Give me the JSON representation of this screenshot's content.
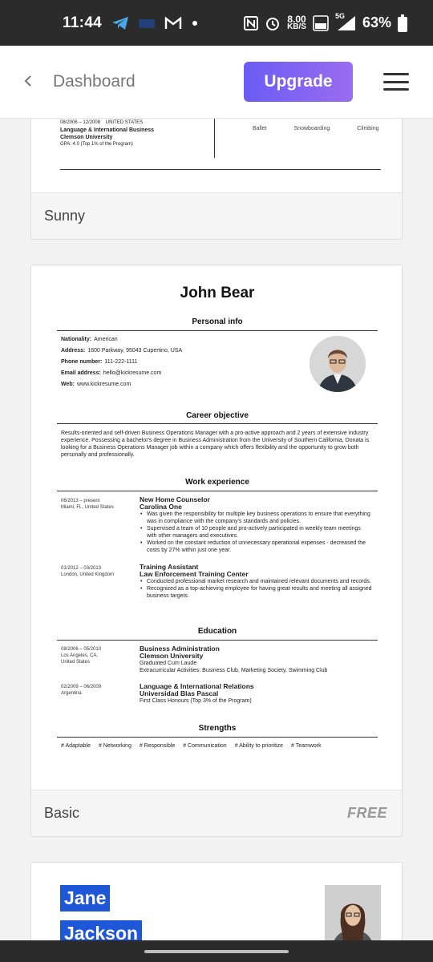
{
  "status_bar": {
    "time": "11:44",
    "speed_value": "8.00",
    "speed_unit": "KB/S",
    "network": "5G",
    "battery": "63%",
    "icons": [
      "telegram-icon",
      "message-icon",
      "gmail-icon",
      "dot-icon",
      "nfc-icon",
      "alarm-icon",
      "volte-icon",
      "signal-icon",
      "battery-icon"
    ]
  },
  "header": {
    "back_icon": "chevron-left-icon",
    "title": "Dashboard",
    "upgrade_label": "Upgrade",
    "menu_icon": "hamburger-menu-icon"
  },
  "cards": [
    {
      "name": "Sunny",
      "snippet": {
        "dates": "08/2006 – 12/2008",
        "location": "UNITED STATES",
        "degree": "Language & International Business",
        "school": "Clemson University",
        "gpa": "GPA: 4.0 (Top 1% of the Program)"
      },
      "hobbies": [
        "Ballet",
        "Snowboarding",
        "Climbing"
      ]
    },
    {
      "name": "Basic",
      "badge": "FREE",
      "resume": {
        "name": "John Bear",
        "sections": {
          "personal": "Personal info",
          "career": "Career objective",
          "work": "Work experience",
          "education": "Education",
          "strengths": "Strengths"
        },
        "personal_info": [
          {
            "label": "Nationality:",
            "value": "American"
          },
          {
            "label": "Address:",
            "value": "1600 Parkway, 95043 Cupertino, USA"
          },
          {
            "label": "Phone number:",
            "value": "111-222-1111"
          },
          {
            "label": "Email address:",
            "value": "hello@kickresume.com"
          },
          {
            "label": "Web:",
            "value": "www.kickresume.com"
          }
        ],
        "career_objective": "Results-oriented and self-driven Business Operations Manager with a pro-active approach and 2 years of extensive industry experience. Possessing a bachelor's degree in Business Administration from the University of Southern California, Donata is looking for a Business Operations Manager job within a company which offers flexibility and the opportunity to grow both personally and professionally.",
        "work": [
          {
            "dates": "06/2013 – present",
            "location": "Miami, FL, United States",
            "title": "New Home Counselor",
            "company": "Carolina One",
            "bullets": [
              "Was given the responsibility for multiple key business operations to ensure that everything was in compliance with the company's standards and policies.",
              "Supervised a team of 10 people and pro-actively participated in weekly team meetings with other managers and executives.",
              "Worked on the constant reduction of unnecessary operational expenses - decreased the costs by 27% within just one year."
            ]
          },
          {
            "dates": "01/2012 – 03/2013",
            "location": "London, United Kingdom",
            "title": "Training Assistant",
            "company": "Law Enforcement Training Center",
            "bullets": [
              "Conducted professional market research and maintained relevant documents and records.",
              "Recognized as a top-achieving employee for having great results and meeting all assigned business targets."
            ]
          }
        ],
        "education": [
          {
            "dates": "08/2006 – 05/2010",
            "location": "Los Angeles, CA,",
            "location2": "United States",
            "degree": "Business Administration",
            "school": "Clemson University",
            "line1": "Graduated Cum Laude",
            "line2": "Extracurricular Activities: Business Club, Marketing Society, Swimming Club"
          },
          {
            "dates": "02/2009 – 06/2009",
            "location": "Argentina",
            "degree": "Language & International Relations",
            "school": "Universidad Blas Pascal",
            "line1": "First Class Honours (Top 3% of the Program)"
          }
        ],
        "strengths": [
          "# Adaptable",
          "# Networking",
          "# Responsible",
          "# Communication",
          "# Ability to prioritize",
          "# Teamwork"
        ]
      }
    },
    {
      "name_first": "Jane",
      "name_last": "Jackson"
    }
  ]
}
